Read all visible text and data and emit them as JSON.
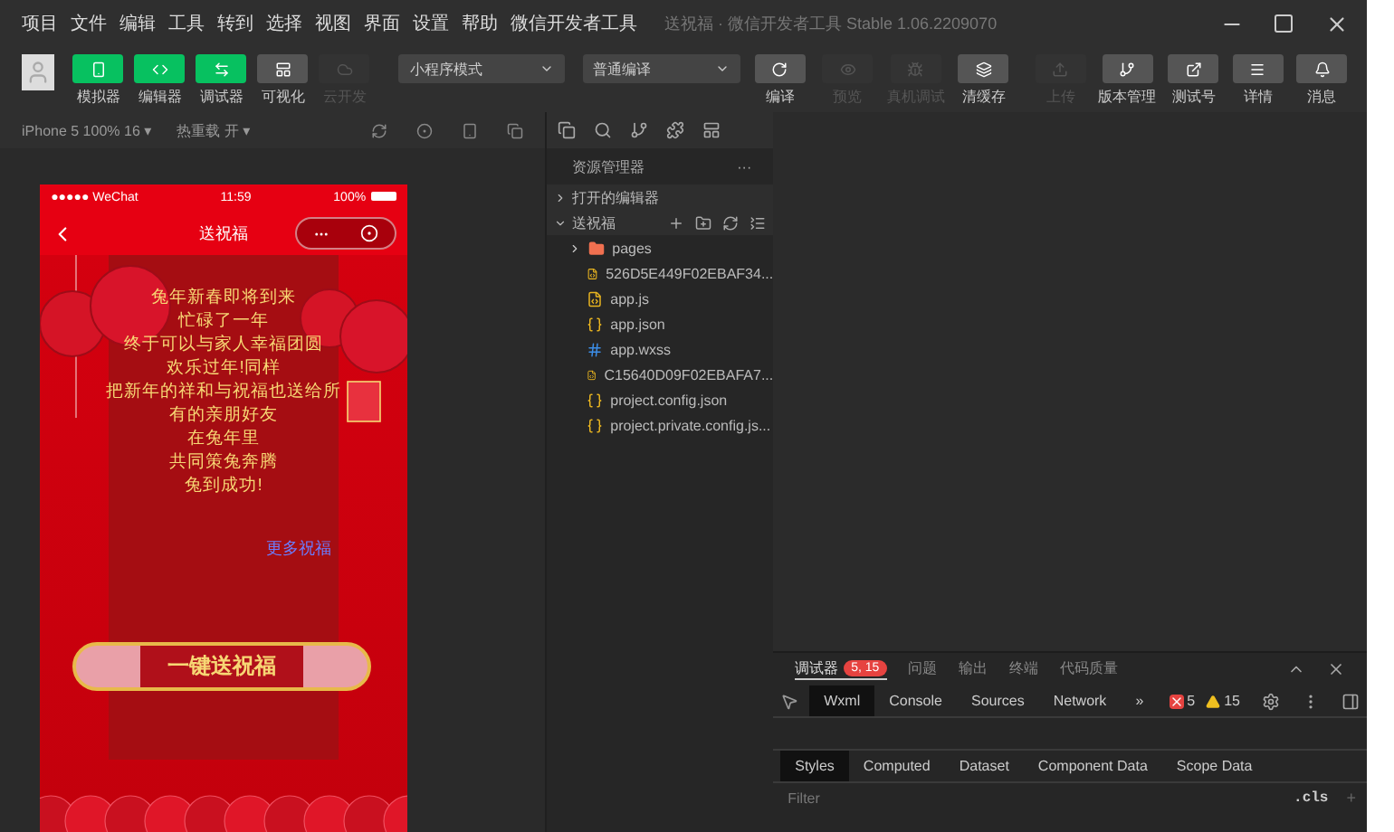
{
  "menu": [
    "项目",
    "文件",
    "编辑",
    "工具",
    "转到",
    "选择",
    "视图",
    "界面",
    "设置",
    "帮助",
    "微信开发者工具"
  ],
  "title": "送祝福 · 微信开发者工具 Stable 1.06.2209070",
  "left_tools": [
    {
      "label": "模拟器",
      "kind": "phone",
      "on": true,
      "disabled": false
    },
    {
      "label": "编辑器",
      "kind": "code",
      "on": true,
      "disabled": false
    },
    {
      "label": "调试器",
      "kind": "debug",
      "on": true,
      "disabled": false
    },
    {
      "label": "可视化",
      "kind": "layout",
      "on": false,
      "disabled": false
    },
    {
      "label": "云开发",
      "kind": "cloud",
      "on": false,
      "disabled": true
    }
  ],
  "mode_select": "小程序模式",
  "compile_select": "普通编译",
  "compile_tools": [
    {
      "label": "编译",
      "kind": "refresh",
      "disabled": false
    },
    {
      "label": "预览",
      "kind": "eye",
      "disabled": true
    },
    {
      "label": "真机调试",
      "kind": "bug",
      "disabled": true
    },
    {
      "label": "清缓存",
      "kind": "layers",
      "disabled": false
    }
  ],
  "right_tools": [
    {
      "label": "上传",
      "kind": "upload",
      "disabled": true
    },
    {
      "label": "版本管理",
      "kind": "branch",
      "disabled": false
    },
    {
      "label": "测试号",
      "kind": "external",
      "disabled": false
    },
    {
      "label": "详情",
      "kind": "menu",
      "disabled": false
    },
    {
      "label": "消息",
      "kind": "bell",
      "disabled": false
    }
  ],
  "sim_bar": {
    "device": "iPhone 5 100% 16 ▾",
    "hot_reload": "热重载 开 ▾"
  },
  "phone": {
    "carrier": "●●●●● WeChat",
    "time": "11:59",
    "battery": "100%",
    "nav_title": "送祝福",
    "poem": [
      "兔年新春即将到来",
      "忙碌了一年",
      "终于可以与家人幸福团圆",
      "欢乐过年!同样",
      "把新年的祥和与祝福也送给所",
      "有的亲朋好友",
      "在兔年里",
      "共同策兔奔腾",
      "兔到成功!"
    ],
    "more_link": "更多祝福",
    "send_button": "一键送祝福"
  },
  "explorer": {
    "title": "资源管理器",
    "more": "···",
    "sections": [
      {
        "label": "打开的编辑器",
        "expanded": false
      },
      {
        "label": "送祝福",
        "expanded": true
      }
    ],
    "files": [
      {
        "name": "pages",
        "kind": "folder"
      },
      {
        "name": "526D5E449F02EBAF34...",
        "kind": "js"
      },
      {
        "name": "app.js",
        "kind": "js"
      },
      {
        "name": "app.json",
        "kind": "json"
      },
      {
        "name": "app.wxss",
        "kind": "wxss"
      },
      {
        "name": "C15640D09F02EBAFA7...",
        "kind": "js"
      },
      {
        "name": "project.config.json",
        "kind": "json"
      },
      {
        "name": "project.private.config.js...",
        "kind": "json"
      }
    ]
  },
  "debugger": {
    "tabs": [
      {
        "label": "调试器",
        "badge": "5, 15",
        "selected": true
      },
      {
        "label": "问题",
        "selected": false
      },
      {
        "label": "输出",
        "selected": false
      },
      {
        "label": "终端",
        "selected": false
      },
      {
        "label": "代码质量",
        "selected": false
      }
    ],
    "dev_tabs": [
      {
        "label": "Wxml",
        "selected": true
      },
      {
        "label": "Console",
        "selected": false
      },
      {
        "label": "Sources",
        "selected": false
      },
      {
        "label": "Network",
        "selected": false
      }
    ],
    "more": "»",
    "errors": "5",
    "warnings": "15",
    "style_tabs": [
      {
        "label": "Styles",
        "selected": true
      },
      {
        "label": "Computed",
        "selected": false
      },
      {
        "label": "Dataset",
        "selected": false
      },
      {
        "label": "Component Data",
        "selected": false
      },
      {
        "label": "Scope Data",
        "selected": false
      }
    ],
    "filter_placeholder": "Filter",
    "cls": ".cls",
    "add": "+"
  }
}
